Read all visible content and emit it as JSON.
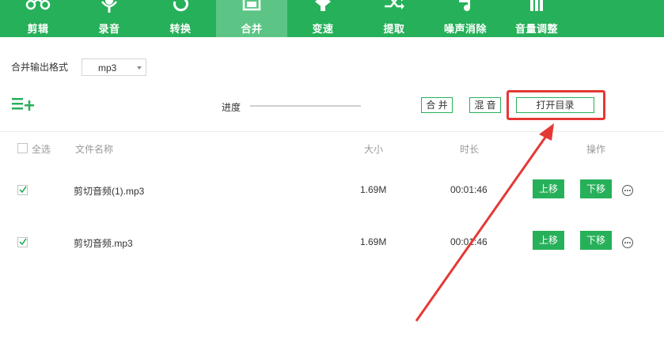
{
  "toolbar": {
    "items": [
      {
        "label": "剪辑",
        "icon": "scissors-icon"
      },
      {
        "label": "录音",
        "icon": "microphone-icon"
      },
      {
        "label": "转换",
        "icon": "refresh-icon"
      },
      {
        "label": "合并",
        "icon": "merge-icon",
        "active": true
      },
      {
        "label": "变速",
        "icon": "speed-icon"
      },
      {
        "label": "提取",
        "icon": "shuffle-icon"
      },
      {
        "label": "噪声消除",
        "icon": "music-note-icon"
      },
      {
        "label": "音量调整",
        "icon": "volume-bars-icon"
      }
    ],
    "accent_color": "#27b05a",
    "active_color": "#5cc585"
  },
  "format": {
    "label": "合并输出格式",
    "selected": "mp3"
  },
  "progress": {
    "label": "进度",
    "value_percent": 0
  },
  "actions": {
    "merge": "合 并",
    "mix": "混 音",
    "open_dir": "打开目录"
  },
  "annotation": {
    "highlight_color": "#e53935"
  },
  "table": {
    "headers": {
      "select_all": "全选",
      "filename": "文件名称",
      "size": "大小",
      "duration": "时长",
      "ops": "操作"
    },
    "select_all_checked": false,
    "rows": [
      {
        "checked": true,
        "filename": "剪切音频(1).mp3",
        "size": "1.69M",
        "duration": "00:01:46",
        "up": "上移",
        "down": "下移"
      },
      {
        "checked": true,
        "filename": "剪切音频.mp3",
        "size": "1.69M",
        "duration": "00:01:46",
        "up": "上移",
        "down": "下移"
      }
    ]
  }
}
